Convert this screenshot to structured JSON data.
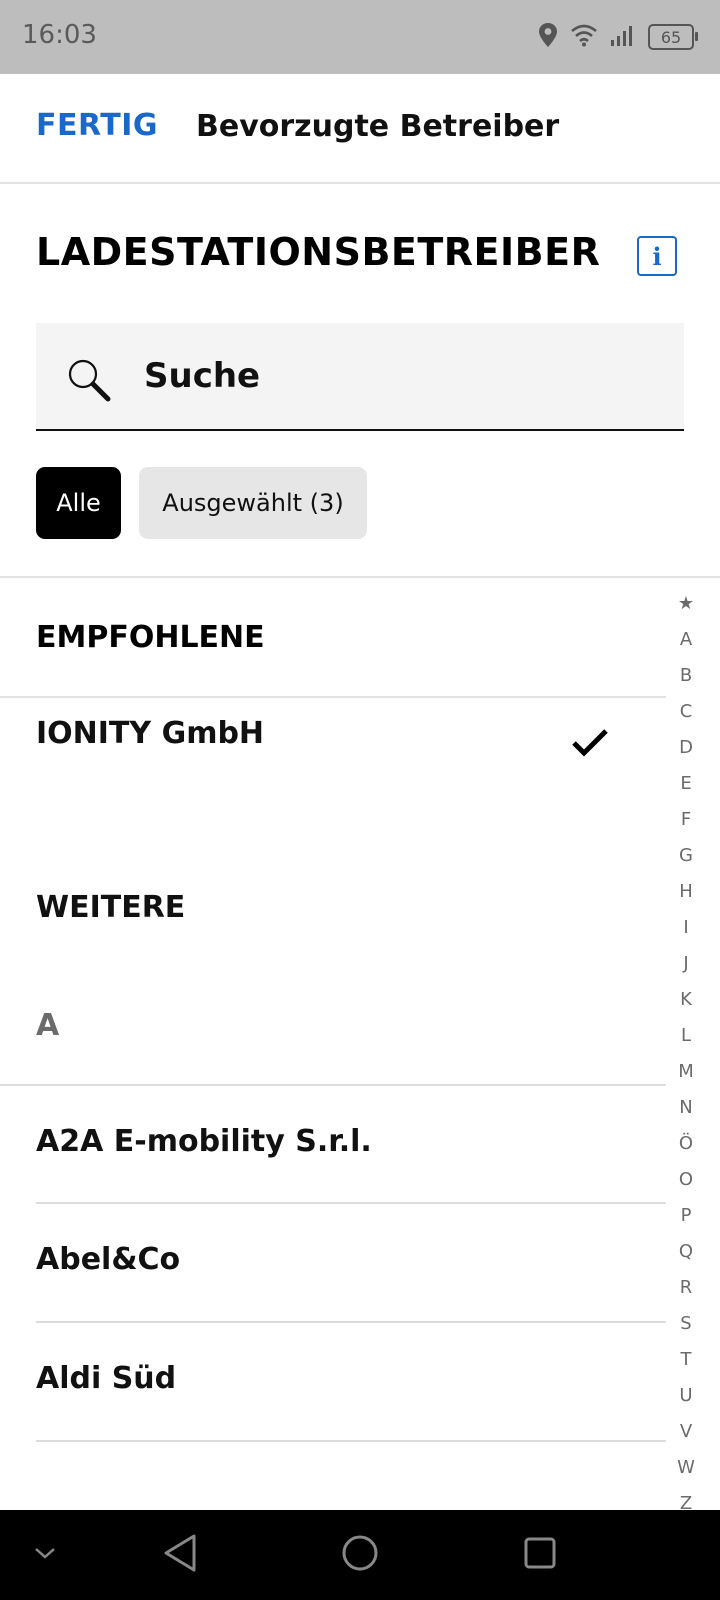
{
  "status_bar": {
    "time": "16:03",
    "battery_level": "65"
  },
  "header": {
    "done_label": "FERTIG",
    "title": "Bevorzugte Betreiber"
  },
  "section": {
    "title": "LADESTATIONSBETREIBER"
  },
  "search": {
    "placeholder": "Suche"
  },
  "filters": {
    "all_label": "Alle",
    "selected_label": "Ausgewählt (3)"
  },
  "list": {
    "recommended_header": "EMPFOHLENE",
    "recommended_items": [
      {
        "label": "IONITY GmbH",
        "checked": true
      }
    ],
    "more_header": "WEITERE",
    "letter_a": "A",
    "items": [
      {
        "label": "A2A E-mobility S.r.l."
      },
      {
        "label": "Abel&Co"
      },
      {
        "label": "Aldi Süd"
      }
    ]
  },
  "alphabet_index": [
    "★",
    "A",
    "B",
    "C",
    "D",
    "E",
    "F",
    "G",
    "H",
    "I",
    "J",
    "K",
    "L",
    "M",
    "N",
    "Ö",
    "O",
    "P",
    "Q",
    "R",
    "S",
    "T",
    "U",
    "V",
    "W",
    "Z"
  ],
  "colors": {
    "accent": "#1a68c7",
    "status_bar_bg": "#bdbdbd",
    "nav_bar_bg": "#000000"
  }
}
